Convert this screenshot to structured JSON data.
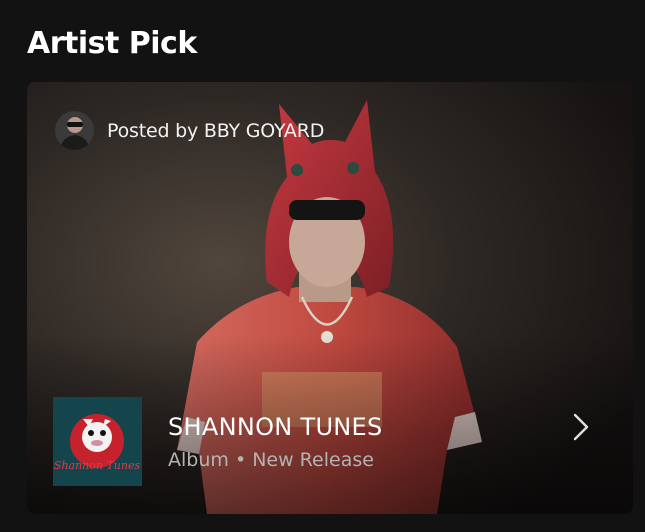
{
  "section": {
    "title": "Artist Pick"
  },
  "card": {
    "posted_by": "Posted by BBY GOYARD",
    "release": {
      "title": "SHANNON TUNES",
      "type": "Album",
      "separator": "•",
      "status": "New Release",
      "cover_text": "Shannon Tunes"
    },
    "icons": {
      "next": "chevron-right-icon"
    },
    "colors": {
      "hood": "#b8343c",
      "shirt": "#c2443e",
      "cover_bg": "#14454d",
      "subtitle": "#b3b3b3"
    }
  }
}
